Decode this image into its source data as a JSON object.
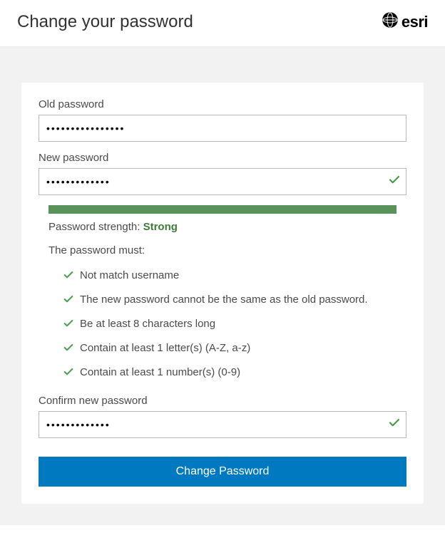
{
  "header": {
    "title": "Change your password",
    "logo_text": "esri"
  },
  "form": {
    "old_password": {
      "label": "Old password",
      "value": "••••••••••••••••"
    },
    "new_password": {
      "label": "New password",
      "value": "•••••••••••••"
    },
    "confirm_password": {
      "label": "Confirm new password",
      "value": "•••••••••••••"
    },
    "submit_label": "Change Password"
  },
  "strength": {
    "prefix": "Password strength: ",
    "level": "Strong",
    "rules_intro": "The password must:",
    "rules": [
      "Not match username",
      "The new password cannot be the same as the old password.",
      "Be at least 8 characters long",
      "Contain at least 1 letter(s) (A-Z, a-z)",
      "Contain at least 1 number(s) (0-9)"
    ]
  }
}
